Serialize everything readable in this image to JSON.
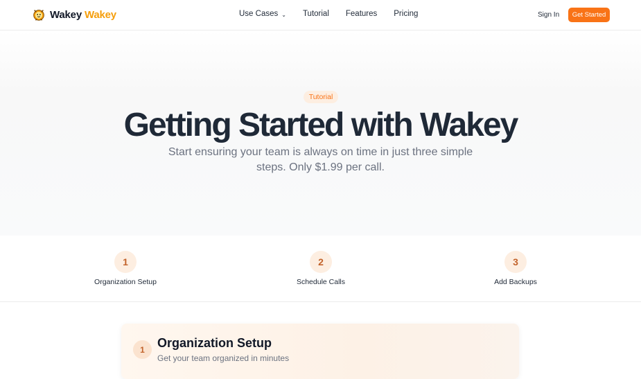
{
  "nav": {
    "brand_first": "Wakey",
    "brand_second": "Wakey",
    "links": [
      "Use Cases",
      "Tutorial",
      "Features",
      "Pricing"
    ],
    "signin": "Sign In",
    "cta": "Get Started"
  },
  "hero": {
    "pill": "Tutorial",
    "title": "Getting Started with Wakey",
    "subtitle": "Start ensuring your team is always on time in just three simple steps. Only $1.99 per call."
  },
  "steps": [
    {
      "number": "1",
      "label": "Organization Setup"
    },
    {
      "number": "2",
      "label": "Schedule Calls"
    },
    {
      "number": "3",
      "label": "Add Backups"
    }
  ],
  "card": {
    "number": "1",
    "title": "Organization Setup",
    "subtitle": "Get your team organized in minutes"
  },
  "colors": {
    "accent": "#f97316",
    "brand_yellow": "#f59e0b",
    "pill_bg": "#fdeee1"
  }
}
